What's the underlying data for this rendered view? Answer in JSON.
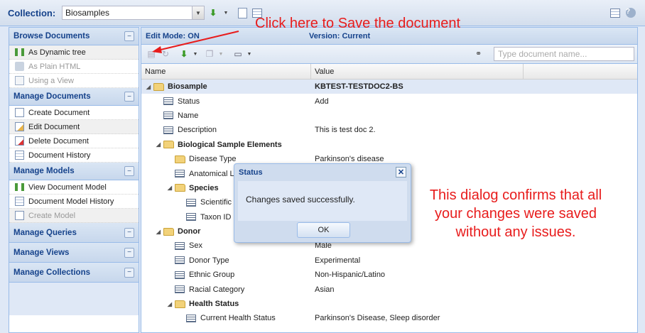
{
  "topbar": {
    "collection_label": "Collection:",
    "collection_value": "Biosamples"
  },
  "sidebar": {
    "sections": [
      {
        "title": "Browse Documents",
        "toggle": "−",
        "items": [
          {
            "label": "As Dynamic tree",
            "icon": "tree-icon"
          },
          {
            "label": "As Plain HTML",
            "icon": "html-icon"
          },
          {
            "label": "Using a View",
            "icon": "view-icon"
          }
        ]
      },
      {
        "title": "Manage Documents",
        "toggle": "−",
        "items": [
          {
            "label": "Create Document",
            "icon": "create-document-icon"
          },
          {
            "label": "Edit Document",
            "icon": "edit-document-icon"
          },
          {
            "label": "Delete Document",
            "icon": "delete-document-icon"
          },
          {
            "label": "Document History",
            "icon": "history-icon"
          }
        ]
      },
      {
        "title": "Manage Models",
        "toggle": "−",
        "items": [
          {
            "label": "View Document Model",
            "icon": "tree-icon"
          },
          {
            "label": "Document Model History",
            "icon": "history-icon"
          },
          {
            "label": "Create Model",
            "icon": "create-model-icon"
          }
        ]
      },
      {
        "title": "Manage Queries",
        "toggle": "−"
      },
      {
        "title": "Manage Views",
        "toggle": "−"
      },
      {
        "title": "Manage Collections",
        "toggle": "−"
      }
    ]
  },
  "main": {
    "edit_mode": "Edit Mode: ON",
    "version": "Version: Current",
    "search_placeholder": "Type document name...",
    "columns": {
      "name": "Name",
      "value": "Value"
    },
    "rows": [
      {
        "name": "Biosample",
        "value": "KBTEST-TESTDOC2-BS"
      },
      {
        "name": "Status",
        "value": "Add"
      },
      {
        "name": "Name",
        "value": ""
      },
      {
        "name": "Description",
        "value": "This is test doc 2."
      },
      {
        "name": "Biological Sample Elements",
        "value": ""
      },
      {
        "name": "Disease Type",
        "value": "Parkinson's disease"
      },
      {
        "name": "Anatomical Lo",
        "value": ""
      },
      {
        "name": "Species",
        "value": ""
      },
      {
        "name": "Scientific N",
        "value": ""
      },
      {
        "name": "Taxon ID",
        "value": ""
      },
      {
        "name": "Donor",
        "value": ""
      },
      {
        "name": "Sex",
        "value": "Male"
      },
      {
        "name": "Donor Type",
        "value": "Experimental"
      },
      {
        "name": "Ethnic Group",
        "value": "Non-Hispanic/Latino"
      },
      {
        "name": "Racial Category",
        "value": "Asian"
      },
      {
        "name": "Health Status",
        "value": ""
      },
      {
        "name": "Current Health Status",
        "value": "Parkinson's Disease, Sleep disorder"
      }
    ]
  },
  "dialog": {
    "title": "Status",
    "message": "Changes saved successfully.",
    "ok_label": "OK",
    "close_glyph": "✕"
  },
  "annotations": {
    "save_note": "Click here to Save the document",
    "dialog_note_lines": [
      "This dialog confirms that all",
      "your changes were saved",
      "without any issues."
    ],
    "color": "#e81c1c"
  }
}
